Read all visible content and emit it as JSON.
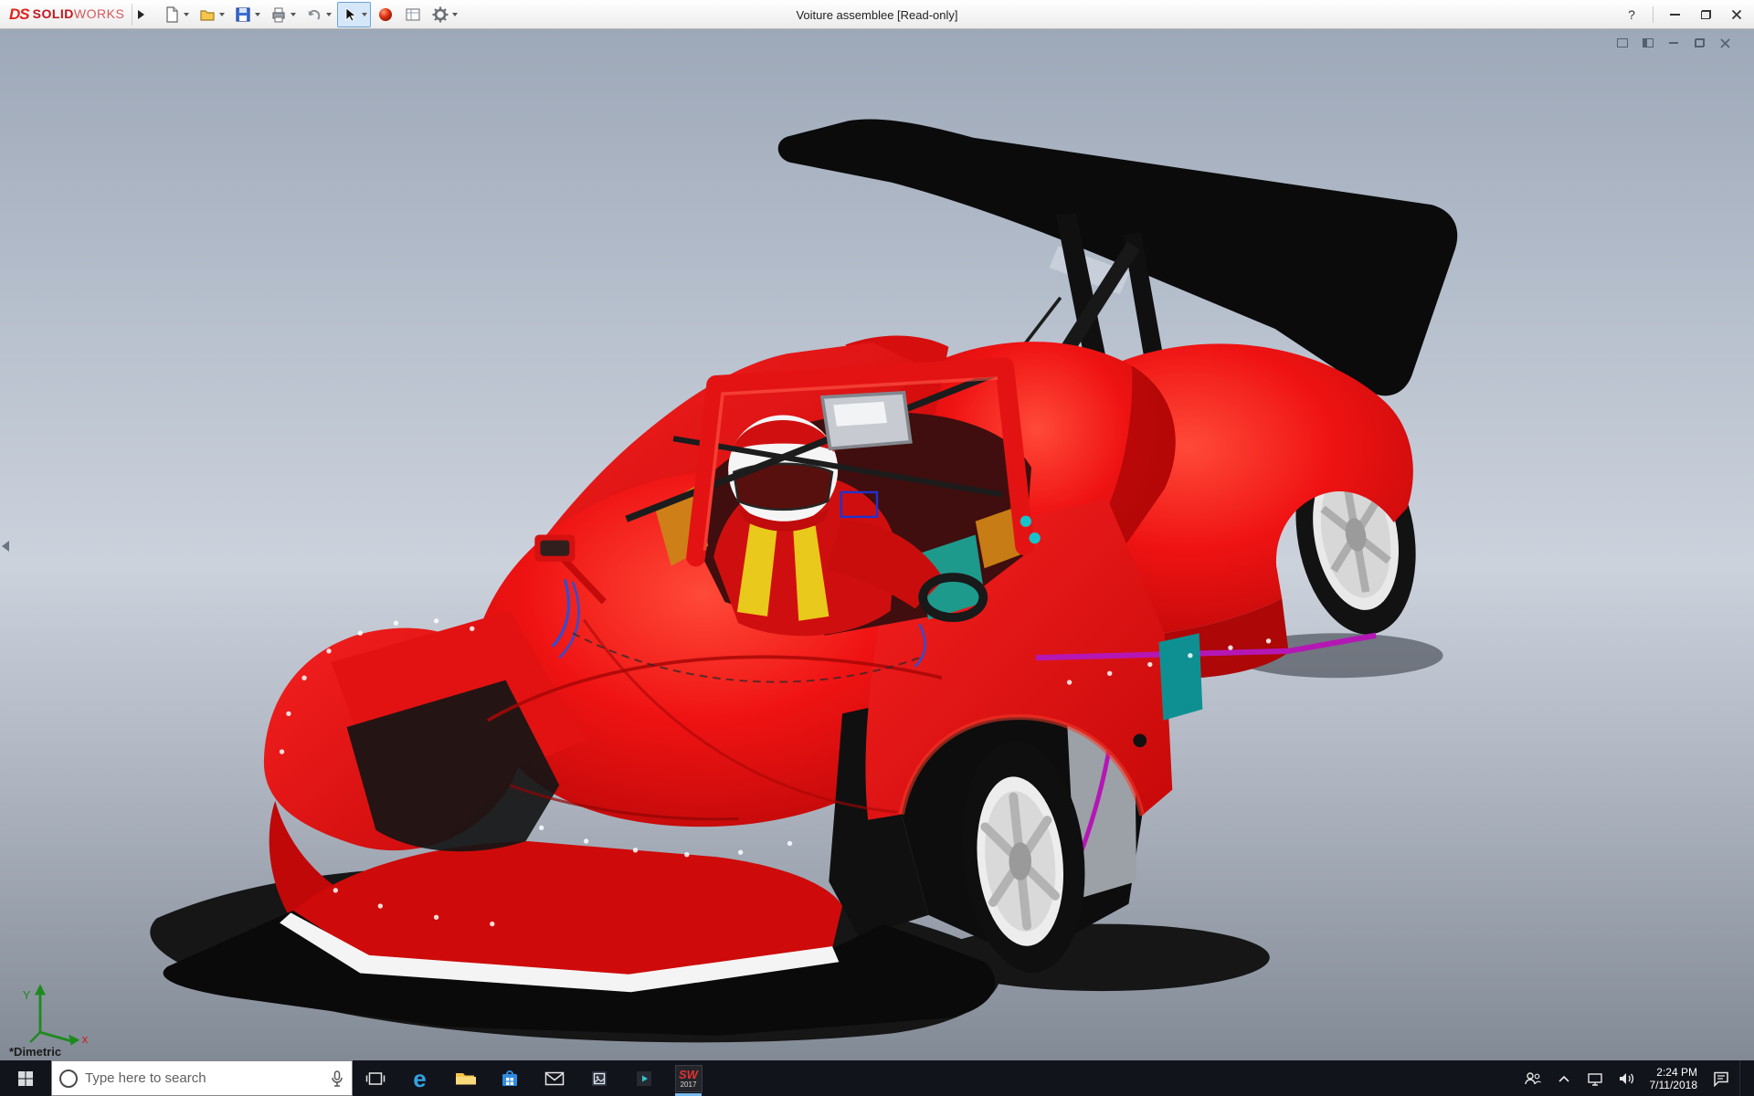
{
  "titlebar": {
    "brand_mark": "DS",
    "brand_bold": "SOLID",
    "brand_light": "WORKS",
    "title": "Voiture assemblee [Read-only]",
    "help": "?"
  },
  "toolbar": {
    "icons": [
      "menu-flyout",
      "new-document",
      "open",
      "save",
      "print",
      "undo",
      "select",
      "appearance",
      "sheet-properties",
      "options"
    ]
  },
  "viewport": {
    "view_label": "*Dimetric",
    "triad": {
      "y": "Y",
      "x": "x"
    },
    "model_colors": {
      "body_red": "#e81010",
      "wing_black": "#0b0b0b",
      "stripe_white": "#f4f4f4",
      "accent_magenta": "#b517b5",
      "accent_teal": "#0e9093",
      "harness_yellow": "#e9c91b",
      "rim_silver": "#ededed"
    }
  },
  "taskbar": {
    "search_placeholder": "Type here to search",
    "edge_glyph": "e",
    "apps": [
      "task-view",
      "edge",
      "file-explorer",
      "store",
      "mail",
      "photos",
      "movies",
      "solidworks-2017"
    ],
    "solidworks_badge": {
      "line1": "SW",
      "line2": "2017"
    },
    "tray": {
      "time": "2:24 PM",
      "date": "7/11/2018"
    }
  }
}
